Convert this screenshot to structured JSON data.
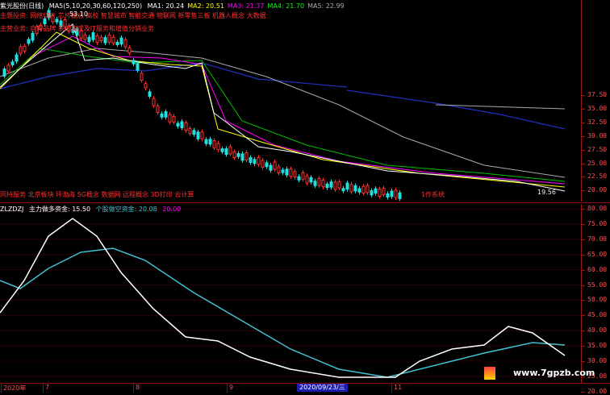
{
  "header": {
    "stock_name": "紫光股份(日线)",
    "ma_summary": "MA5(5,10,20,30,60,120,250)",
    "ma_values": [
      {
        "label": "MA1: 20.24",
        "color": "#ffffff"
      },
      {
        "label": "MA2: 20.51",
        "color": "#ffff00"
      },
      {
        "label": "MA3: 21.37",
        "color": "#ff00ff"
      },
      {
        "label": "MA4: 21.70",
        "color": "#00ff00"
      },
      {
        "label": "MA5: 22.99",
        "color": "#aaaaaa"
      }
    ]
  },
  "tags_row": "主题投资: 网络切片 芯片概念 高校 智慧城市 智能交通 物联网 新零售三板 机器人概念 大数据",
  "business_row": "主营业务: 自有品牌 系统集成及IT服务和增值分销业务",
  "concepts_row": "同持服务 北京板块 环渤海 5G概念 数据网 远程概念 3D打印 云计算",
  "logic_label": "1作系统",
  "price_axis": [
    "37.50",
    "35.00",
    "32.50",
    "30.00",
    "27.50",
    "25.00",
    "22.50",
    "20.00"
  ],
  "last_price": "19.56",
  "high_price": "53.10",
  "indicator": {
    "name": "ZLZDZJ",
    "line1_label": "主力做多资金: 15.50",
    "line2_label": "个股做空资金: 20.08",
    "line3_label": "20.00",
    "colors": {
      "line1": "#ffffff",
      "line2": "#40c0d0"
    }
  },
  "indicator_axis": [
    "80.00",
    "75.00",
    "70.00",
    "65.00",
    "60.00",
    "55.00",
    "50.00",
    "45.00",
    "40.00",
    "35.00",
    "30.00",
    "25.00",
    "20.00"
  ],
  "time_axis": [
    "2020年",
    "7",
    "8",
    "9",
    "11"
  ],
  "date_marker": "2020/09/23/三",
  "watermark": "www.7gpzb.com"
}
